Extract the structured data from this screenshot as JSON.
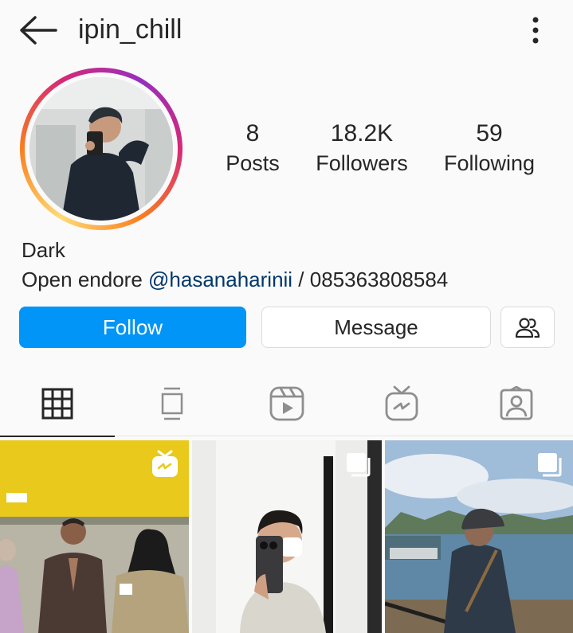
{
  "header": {
    "username": "ipin_chill",
    "back_icon": "arrow-left-icon",
    "menu_icon": "more-vertical-icon"
  },
  "profile": {
    "avatar": "profile-photo",
    "stats": {
      "posts": {
        "value": "8",
        "label": "Posts"
      },
      "followers": {
        "value": "18.2K",
        "label": "Followers"
      },
      "following": {
        "value": "59",
        "label": "Following"
      }
    },
    "name": "Dark",
    "bio": {
      "prefix": "Open endore ",
      "mention": "@hasanaharinii",
      "suffix": " / 085363808584"
    }
  },
  "actions": {
    "follow_label": "Follow",
    "message_label": "Message",
    "suggest_icon": "add-people-icon"
  },
  "tabs": [
    {
      "icon": "grid-icon",
      "active": true
    },
    {
      "icon": "guides-icon",
      "active": false
    },
    {
      "icon": "reels-icon",
      "active": false
    },
    {
      "icon": "igtv-icon",
      "active": false
    },
    {
      "icon": "tagged-icon",
      "active": false
    }
  ],
  "posts": [
    {
      "type": "igtv",
      "badge_icon": "igtv-icon"
    },
    {
      "type": "carousel",
      "badge_icon": "carousel-icon"
    },
    {
      "type": "carousel",
      "badge_icon": "carousel-icon"
    }
  ],
  "colors": {
    "accent": "#0095f6",
    "text": "#262626",
    "mention": "#00376b",
    "border": "#dbdbdb"
  }
}
